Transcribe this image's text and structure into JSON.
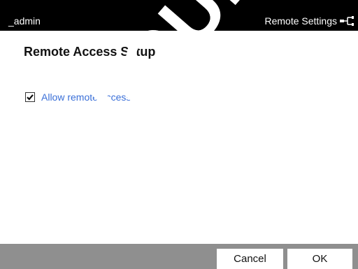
{
  "titlebar": {
    "left_label": "_admin",
    "right_label": "Remote Settings",
    "icon": "network-icon"
  },
  "main": {
    "title": "Remote Access Setup",
    "option": {
      "label": "Allow remote access",
      "checked": true,
      "label_color": "#3a6fd8"
    }
  },
  "footer": {
    "cancel_label": "Cancel",
    "ok_label": "OK"
  },
  "watermark": {
    "text": "NIQUE"
  },
  "colors": {
    "titlebar_bg": "#000000",
    "footer_bg": "#8f8f8f",
    "link_blue": "#3a6fd8"
  }
}
